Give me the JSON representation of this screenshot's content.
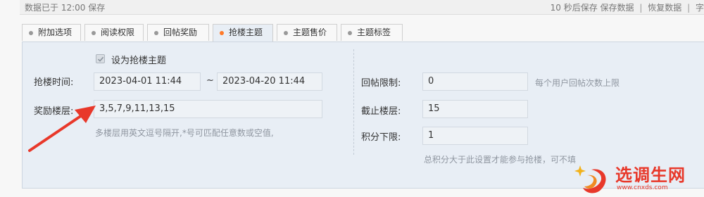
{
  "status": {
    "left_text": "数据已于 12:00 保存",
    "autosave_text": "10 秒后保存",
    "save_link": "保存数据",
    "restore_link": "恢复数据",
    "overflow_text": "字"
  },
  "tabs": [
    {
      "label": "附加选项",
      "active": false
    },
    {
      "label": "阅读权限",
      "active": false
    },
    {
      "label": "回帖奖励",
      "active": false
    },
    {
      "label": "抢楼主题",
      "active": true
    },
    {
      "label": "主题售价",
      "active": false
    },
    {
      "label": "主题标签",
      "active": false
    }
  ],
  "form": {
    "set_floor_topic_label": "设为抢楼主题",
    "set_floor_topic_checked": true,
    "time_label": "抢楼时间:",
    "start_time": "2023-04-01 11:44",
    "range_sep": "~",
    "end_time": "2023-04-20 11:44",
    "reward_floors_label": "奖励楼层:",
    "reward_floors_value": "3,5,7,9,11,13,15",
    "reward_floors_hint": "多楼层用英文逗号隔开,*号可匹配任意数或空值,",
    "reply_limit_label": "回帖限制:",
    "reply_limit_value": "0",
    "reply_limit_hint": "每个用户回帖次数上限",
    "stop_floor_label": "截止楼层:",
    "stop_floor_value": "15",
    "credit_min_label": "积分下限:",
    "credit_min_value": "1",
    "credit_min_hint": "总积分大于此设置才能参与抢楼，可不填"
  },
  "watermark": {
    "text": "选调生网",
    "url": "www.cnxds.com"
  },
  "colors": {
    "panel_bg": "#e8eef5",
    "active_dot": "#ff7a2a",
    "arrow": "#e8382a"
  }
}
